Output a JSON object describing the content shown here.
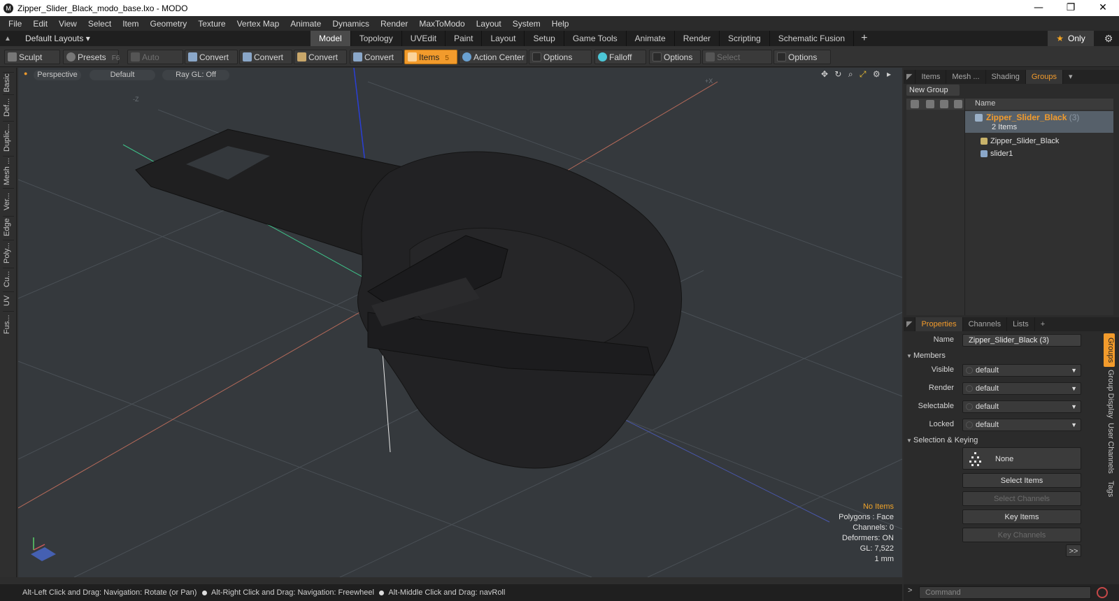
{
  "window": {
    "title": "Zipper_Slider_Black_modo_base.lxo - MODO",
    "app_icon": "M",
    "controls": [
      "—",
      "❐",
      "✕"
    ]
  },
  "menu": [
    "File",
    "Edit",
    "View",
    "Select",
    "Item",
    "Geometry",
    "Texture",
    "Vertex Map",
    "Animate",
    "Dynamics",
    "Render",
    "MaxToModo",
    "Layout",
    "System",
    "Help"
  ],
  "layoutbar": {
    "layouts_label": "Default Layouts ▾",
    "tabs": [
      "Model",
      "Topology",
      "UVEdit",
      "Paint",
      "Layout",
      "Setup",
      "Game Tools",
      "Animate",
      "Render",
      "Scripting",
      "Schematic Fusion"
    ],
    "active_tab": "Model",
    "add_tab": "+",
    "only_label": "Only"
  },
  "toolbar": {
    "sculpt": "Sculpt",
    "presets": "Presets",
    "presets_key": "F6",
    "auto_select": "Auto Select",
    "convert1": "Convert",
    "convert2": "Convert",
    "convert3": "Convert",
    "convert4": "Convert",
    "items": "Items",
    "items_key": "5",
    "action_center": "Action Center",
    "options1": "Options",
    "falloff": "Falloff",
    "options2": "Options",
    "select_through": "Select Through",
    "options3": "Options"
  },
  "leftstrip": [
    "Basic",
    "Def...",
    "Duplic...",
    "Mesh ...",
    "Ver...",
    "Edge",
    "Poly...",
    "Cu...",
    "UV",
    "Fus..."
  ],
  "viewport": {
    "view": "Perspective",
    "shading": "Default",
    "raygl": "Ray GL: Off",
    "axis_z": "-Z",
    "axis_x": "+X",
    "tools": [
      "✥",
      "↻",
      "⌕",
      "⤢",
      "⚙",
      "▸"
    ],
    "info": {
      "no_items": "No Items",
      "polygons": "Polygons : Face",
      "channels": "Channels: 0",
      "deformers": "Deformers: ON",
      "gl": "GL: 7,522",
      "unit": "1 mm"
    }
  },
  "statusbar": {
    "hint1": "Alt-Left Click and Drag: Navigation: Rotate (or Pan)",
    "hint2": "Alt-Right Click and Drag: Navigation: Freewheel",
    "hint3": "Alt-Middle Click and Drag: navRoll"
  },
  "items_panel": {
    "tabs": [
      "Items",
      "Mesh ...",
      "Shading",
      "Groups"
    ],
    "active_tab": "Groups",
    "new_group": "New Group",
    "col_name": "Name",
    "group_name": "Zipper_Slider_Black",
    "group_count": "(3)",
    "group_items": "2 Items",
    "children": [
      "Zipper_Slider_Black",
      "slider1"
    ]
  },
  "properties": {
    "tabs": [
      "Properties",
      "Channels",
      "Lists",
      "+"
    ],
    "active_tab": "Properties",
    "name_label": "Name",
    "name_value": "Zipper_Slider_Black (3)",
    "members_label": "Members",
    "visible_label": "Visible",
    "visible_value": "default",
    "render_label": "Render",
    "render_value": "default",
    "selectable_label": "Selectable",
    "selectable_value": "default",
    "locked_label": "Locked",
    "locked_value": "default",
    "keying_label": "Selection & Keying",
    "none_label": "None",
    "select_items": "Select Items",
    "select_channels": "Select Channels",
    "key_items": "Key Items",
    "key_channels": "Key Channels",
    "more": ">>",
    "side_tabs": [
      "Groups",
      "Group Display",
      "User Channels",
      "Tags"
    ]
  },
  "command": {
    "prompt": ">",
    "placeholder": "Command"
  },
  "colors": {
    "accent": "#f29b2c",
    "viewport_bg": "#35393d"
  }
}
